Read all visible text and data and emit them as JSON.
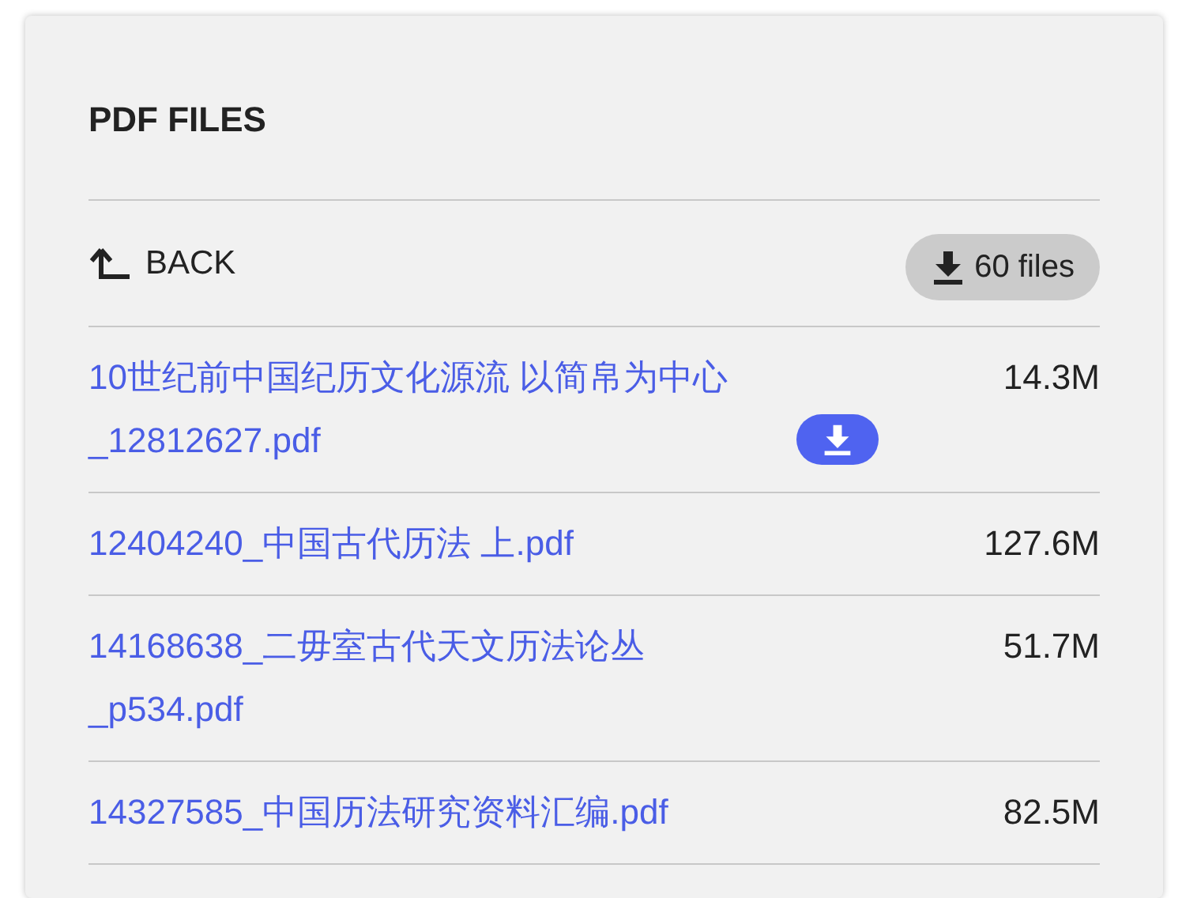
{
  "title": "PDF FILES",
  "back": {
    "label": "BACK"
  },
  "download_all": {
    "label": "60 files"
  },
  "files": [
    {
      "name": "10世纪前中国纪历文化源流 以简帛为中心_12812627.pdf",
      "size": "14.3M",
      "hovered": true
    },
    {
      "name": "12404240_中国古代历法 上.pdf",
      "size": "127.6M",
      "hovered": false
    },
    {
      "name": "14168638_二毋室古代天文历法论丛_p534.pdf",
      "size": "51.7M",
      "hovered": false
    },
    {
      "name": "14327585_中国历法研究资料汇编.pdf",
      "size": "82.5M",
      "hovered": false
    }
  ]
}
